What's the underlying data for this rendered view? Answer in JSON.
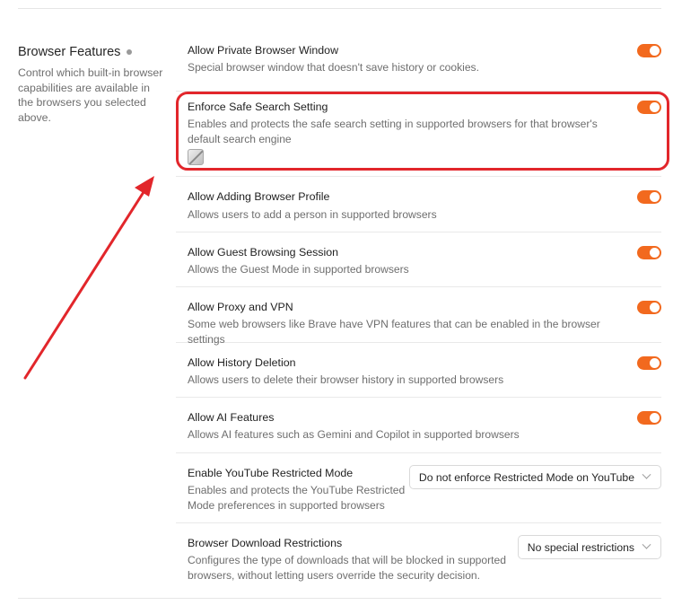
{
  "section": {
    "title": "Browser Features",
    "description": "Control which built-in browser capabilities are available in the browsers you selected above."
  },
  "settings": [
    {
      "label": "Allow Private Browser Window",
      "description": "Special browser window that doesn't save history or cookies.",
      "control": "toggle",
      "on": true
    },
    {
      "label": "Enforce Safe Search Setting",
      "description": "Enables and protects the safe search setting in supported browsers for that browser's default search engine",
      "control": "toggle",
      "on": true
    },
    {
      "label": "Allow Adding Browser Profile",
      "description": "Allows users to add a person in supported browsers",
      "control": "toggle",
      "on": true
    },
    {
      "label": "Allow Guest Browsing Session",
      "description": "Allows the Guest Mode in supported browsers",
      "control": "toggle",
      "on": true
    },
    {
      "label": "Allow Proxy and VPN",
      "description": "Some web browsers like Brave have VPN features that can be enabled in the browser settings",
      "control": "toggle",
      "on": true
    },
    {
      "label": "Allow History Deletion",
      "description": "Allows users to delete their browser history in supported browsers",
      "control": "toggle",
      "on": true
    },
    {
      "label": "Allow AI Features",
      "description": "Allows AI features such as Gemini and Copilot in supported browsers",
      "control": "toggle",
      "on": true
    },
    {
      "label": "Enable YouTube Restricted Mode",
      "description": "Enables and protects the YouTube Restricted Mode preferences in supported browsers",
      "control": "select",
      "value": "Do not enforce Restricted Mode on YouTube"
    },
    {
      "label": "Browser Download Restrictions",
      "description": "Configures the type of downloads that will be blocked in supported browsers, without letting users override the security decision.",
      "control": "select",
      "value": "No special restrictions"
    }
  ],
  "colors": {
    "toggle_on": "#f2691e",
    "annotation_red": "#e2262b"
  },
  "icons": {
    "section_info": "info-dot-icon",
    "select_chevron": "chevron-down-icon",
    "disabled_lock": "lock-placeholder-icon"
  }
}
